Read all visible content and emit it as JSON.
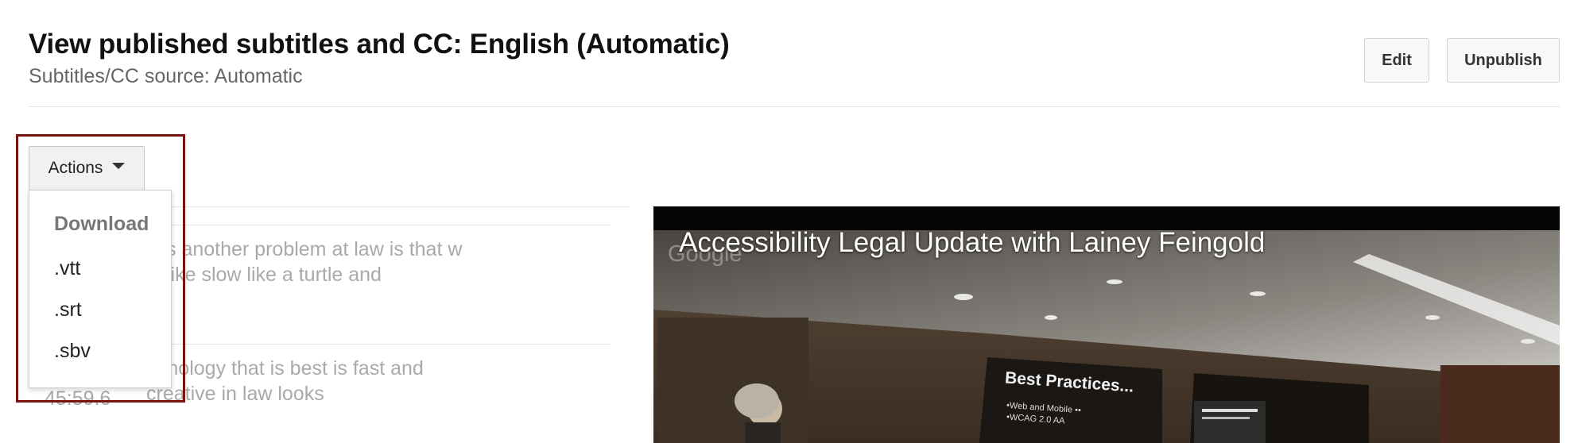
{
  "header": {
    "title": "View published subtitles and CC: English (Automatic)",
    "subtitle": "Subtitles/CC source: Automatic"
  },
  "buttons": {
    "edit": "Edit",
    "unpublish": "Unpublish"
  },
  "actions": {
    "label": "Actions",
    "menu": {
      "header": "Download",
      "items": [
        ".vtt",
        ".srt",
        ".sbv"
      ]
    }
  },
  "captions": [
    {
      "time": "",
      "text": "s is another problem at law is that w is like slow like a turtle and"
    },
    {
      "time": "45:59.6",
      "text": "chnology that is best is fast and creative in law looks"
    }
  ],
  "video": {
    "title": "Accessibility Legal Update with Lainey Feingold",
    "logo": "Google",
    "slide_title": "Best Practices...",
    "slide_bullets": [
      "•Web and Mobile ••",
      "•WCAG 2.0 AA"
    ]
  },
  "colors": {
    "highlight": "#7a1212",
    "divider": "#e0e0e0"
  }
}
